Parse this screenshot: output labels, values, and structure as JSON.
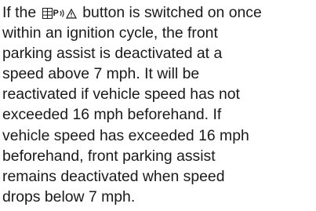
{
  "icon": "parking-assist-icon",
  "paragraph": {
    "lines": [
      "If the",
      "button is switched on once",
      "within an ignition cycle, the front",
      "parking assist is deactivated at a",
      "speed above 7 mph. It will be",
      "reactivated if vehicle speed has not",
      "exceeded 16 mph beforehand. If",
      "vehicle speed has exceeded 16 mph",
      "beforehand, front parking assist",
      "remains deactivated when speed",
      "drops below 7 mph."
    ]
  }
}
